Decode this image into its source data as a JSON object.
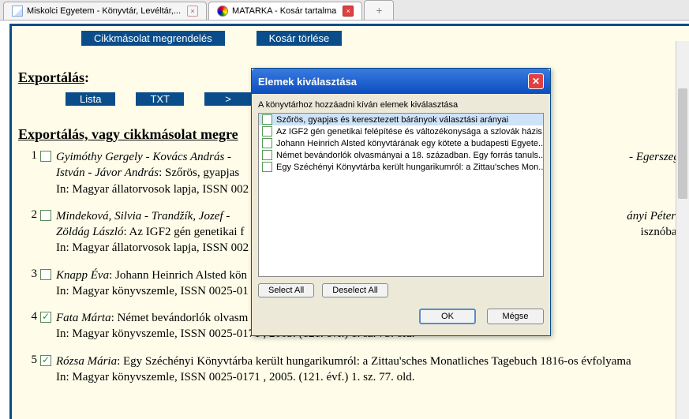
{
  "tabs": {
    "t1": "Miskolci Egyetem - Könyvtár, Levéltár,...",
    "t2": "MATARKA - Kosár tartalma",
    "new": "+"
  },
  "top": {
    "order": "Cikkmásolat megrendelés",
    "clear": "Kosár törlése"
  },
  "export": {
    "title": "Exportálás",
    "colon": ":",
    "btn1": "Lista",
    "btn2": "TXT",
    "btn3": ">"
  },
  "section2": "Exportálás, vagy cikkmásolat megre",
  "items": [
    {
      "n": "1",
      "checked": false,
      "authors": "Gyimóthy Gergely - Kovács András - ",
      "tail": " - Egerszegi",
      "line2a": "István - Jávor András",
      "line2b": ": Szőrös, gyapjas ",
      "line3": "In: Magyar állatorvosok lapja, ISSN 002"
    },
    {
      "n": "2",
      "checked": false,
      "authors": "Mindeková, Silvia - Trandžík, Jozef - ",
      "tail": "ányi Péter -",
      "line2a": "Zöldág László",
      "line2b": ": Az IGF2 gén genetikai f",
      "line2c": "isznóban",
      "line3": "In: Magyar állatorvosok lapja, ISSN 002"
    },
    {
      "n": "3",
      "checked": false,
      "authors": "Knapp Éva",
      "title": ": Johann Heinrich Alsted kön",
      "line3": "In: Magyar könyvszemle, ISSN 0025-01"
    },
    {
      "n": "4",
      "checked": true,
      "authors": "Fata Márta",
      "title": ": Német bevándorlók olvasm",
      "line3": "In: Magyar könyvszemle, ISSN 0025-0171 , 2005. (121. évf.) 1. sz. 73. old."
    },
    {
      "n": "5",
      "checked": true,
      "authors": "Rózsa Mária",
      "title": ": Egy Széchényi Könyvtárba került hungarikumról: a Zittau'sches Monatliches Tagebuch 1816-os évfolyama",
      "line3": "In: Magyar könyvszemle, ISSN 0025-0171 , 2005. (121. évf.) 1. sz. 77. old."
    }
  ],
  "dialog": {
    "title": "Elemek kiválasztása",
    "desc": "A könyvtárhoz hozzáadni kíván elemek kiválasztása",
    "items": [
      "Szőrös, gyapjas és keresztezett bárányok választási arányai",
      "Az IGF2 gén genetikai felépítése és változékonysága a szlovák házis...",
      "Johann Heinrich Alsted könyvtárának egy kötete a budapesti Egyete...",
      "Német bevándorlók olvasmányai a 18. században. Egy forrás tanuls...",
      "Egy Széchényi Könyvtárba került hungarikumról: a Zittau'sches Mon..."
    ],
    "selectAll": "Select All",
    "deselectAll": "Deselect All",
    "ok": "OK",
    "cancel": "Mégse"
  }
}
